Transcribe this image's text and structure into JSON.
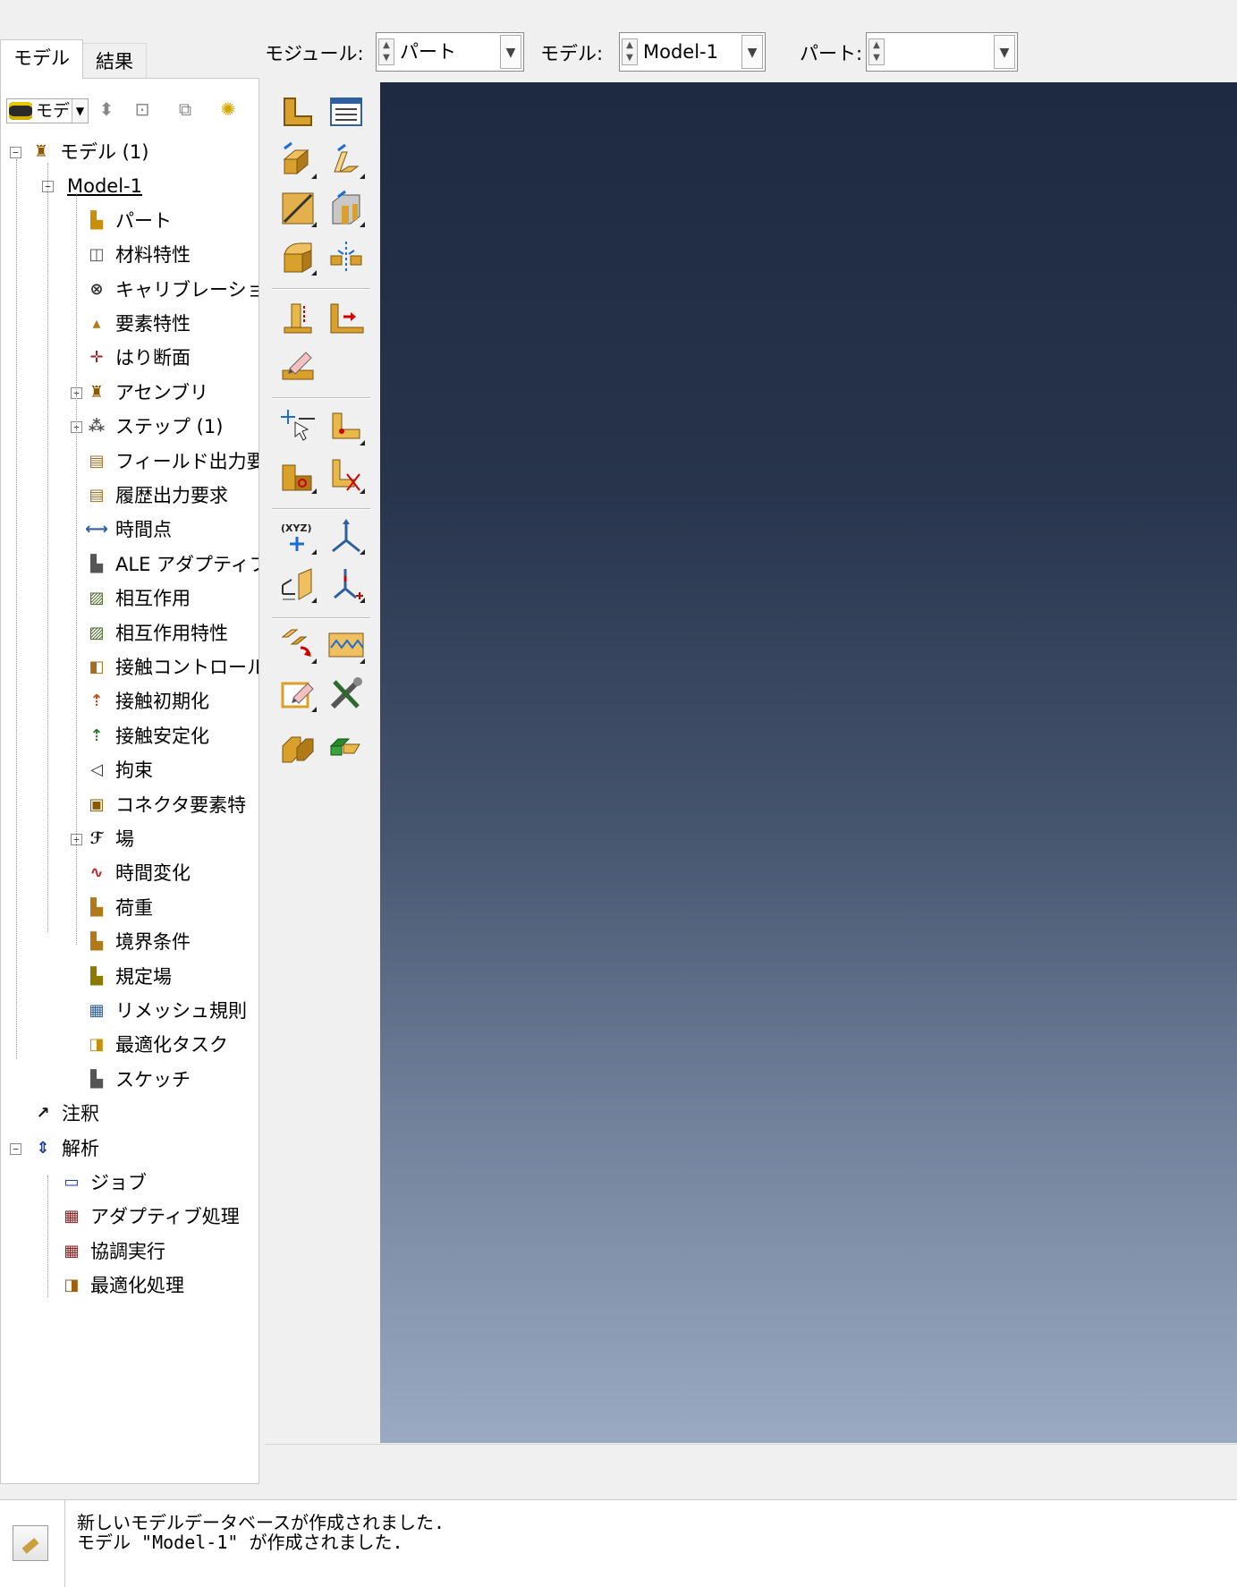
{
  "tabs": {
    "model": "モデル",
    "results": "結果"
  },
  "tree_toolbar": {
    "combo_value": "モデ"
  },
  "tree": [
    {
      "label": "モデル (1)",
      "icon": "assembly-icon",
      "expander": "minus"
    },
    {
      "label": "Model-1",
      "icon": "",
      "expander": "minus"
    },
    {
      "label": "パート",
      "icon": "part-icon"
    },
    {
      "label": "材料特性",
      "icon": "material-icon"
    },
    {
      "label": "キャリブレーション",
      "icon": "calibration-icon"
    },
    {
      "label": "要素特性",
      "icon": "section-icon"
    },
    {
      "label": "はり断面",
      "icon": "beam-profile-icon"
    },
    {
      "label": "アセンブリ",
      "icon": "assembly-icon",
      "expander": "plus"
    },
    {
      "label": "ステップ (1)",
      "icon": "step-icon",
      "expander": "plus"
    },
    {
      "label": "フィールド出力要",
      "icon": "field-output-icon"
    },
    {
      "label": "履歴出力要求",
      "icon": "history-output-icon"
    },
    {
      "label": "時間点",
      "icon": "time-points-icon"
    },
    {
      "label": "ALE アダプティブ",
      "icon": "ale-icon"
    },
    {
      "label": "相互作用",
      "icon": "interaction-icon"
    },
    {
      "label": "相互作用特性",
      "icon": "interaction-property-icon"
    },
    {
      "label": "接触コントロール",
      "icon": "contact-control-icon"
    },
    {
      "label": "接触初期化",
      "icon": "contact-init-icon"
    },
    {
      "label": "接触安定化",
      "icon": "contact-stabilization-icon"
    },
    {
      "label": "拘束",
      "icon": "constraint-icon"
    },
    {
      "label": "コネクタ要素特",
      "icon": "connector-icon"
    },
    {
      "label": "場",
      "icon": "field-icon",
      "expander": "plus"
    },
    {
      "label": "時間変化",
      "icon": "amplitude-icon"
    },
    {
      "label": "荷重",
      "icon": "load-icon"
    },
    {
      "label": "境界条件",
      "icon": "bc-icon"
    },
    {
      "label": "規定場",
      "icon": "predefined-field-icon"
    },
    {
      "label": "リメッシュ規則",
      "icon": "remesh-icon"
    },
    {
      "label": "最適化タスク",
      "icon": "optimization-icon"
    },
    {
      "label": "スケッチ",
      "icon": "sketch-icon"
    },
    {
      "label": "注釈",
      "icon": "annotation-icon"
    },
    {
      "label": "解析",
      "icon": "analysis-icon",
      "expander": "minus"
    },
    {
      "label": "ジョブ",
      "icon": "job-icon"
    },
    {
      "label": "アダプティブ処理",
      "icon": "adaptivity-icon"
    },
    {
      "label": "協調実行",
      "icon": "co-execution-icon"
    },
    {
      "label": "最適化処理",
      "icon": "optimization-process-icon"
    }
  ],
  "context_bar": {
    "module_label": "モジュール:",
    "module_value": "パート",
    "model_label": "モデル:",
    "model_value": "Model-1",
    "part_label": "パート:",
    "part_value": ""
  },
  "messages": [
    "新しいモデルデータベースが作成されました.",
    "モデル \"Model-1\" が作成されました."
  ]
}
